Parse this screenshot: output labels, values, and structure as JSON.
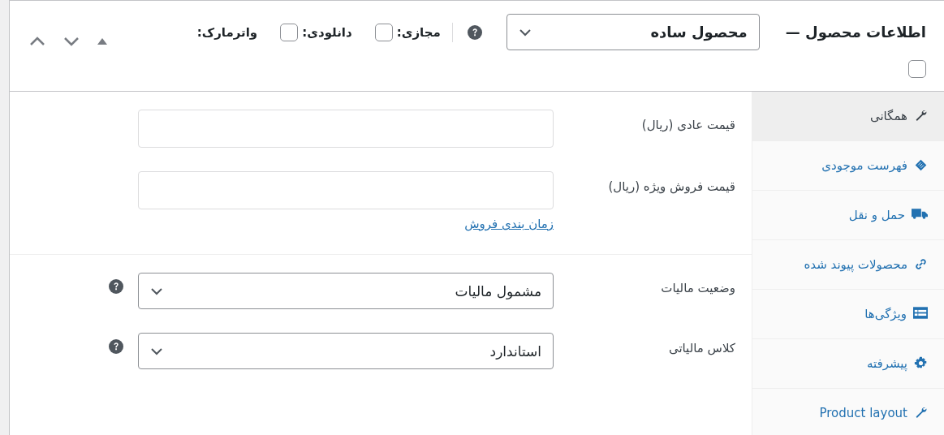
{
  "header": {
    "title": "اطلاعات محصول —",
    "product_type": {
      "value": "محصول ساده"
    },
    "options": [
      {
        "label": "مجازی:",
        "checked": false
      },
      {
        "label": "دانلودی:",
        "checked": false
      },
      {
        "label": "واترمارک:",
        "checked": false
      }
    ]
  },
  "tabs": [
    {
      "label": "همگانی",
      "selected": true
    },
    {
      "label": "فهرست موجودی",
      "selected": false
    },
    {
      "label": "حمل و نقل",
      "selected": false
    },
    {
      "label": "محصولات پیوند شده",
      "selected": false
    },
    {
      "label": "ویژگی‌ها",
      "selected": false
    },
    {
      "label": "پیشرفته",
      "selected": false
    },
    {
      "label": "Product layout",
      "selected": false
    }
  ],
  "pricing": {
    "fields": [
      {
        "label": "قیمت عادی (ریال)"
      },
      {
        "label": "قیمت فروش ویژه (ریال)"
      }
    ],
    "schedule_link": "زمان بندی فروش"
  },
  "tax": {
    "fields": [
      {
        "label": "وضعیت مالیات",
        "value": "مشمول مالیات"
      },
      {
        "label": "کلاس مالیاتی",
        "value": "استاندارد"
      }
    ]
  }
}
